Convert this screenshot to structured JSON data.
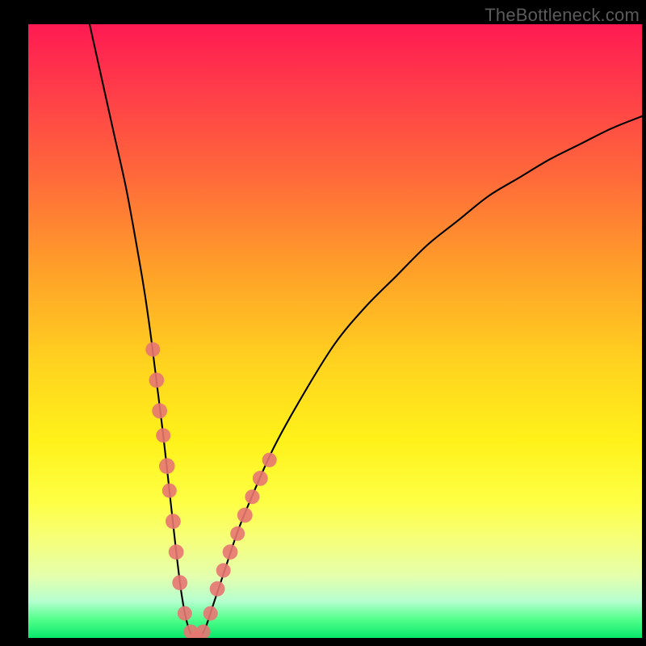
{
  "brand": "TheBottleneck.com",
  "colors": {
    "dot": "#e77572",
    "curve": "#000000",
    "frame": "#000000"
  },
  "chart_data": {
    "type": "line",
    "title": "",
    "xlabel": "",
    "ylabel": "",
    "xlim": [
      0,
      100
    ],
    "ylim": [
      0,
      100
    ],
    "grid": false,
    "legend": false,
    "annotations": [],
    "series": [
      {
        "name": "bottleneck-curve",
        "x": [
          10,
          12,
          14,
          16,
          18,
          19,
          20,
          21,
          22,
          23,
          24,
          25,
          26,
          27,
          28,
          29,
          30,
          32,
          34,
          36,
          40,
          45,
          50,
          55,
          60,
          65,
          70,
          75,
          80,
          85,
          90,
          95,
          100
        ],
        "y": [
          100,
          91,
          82,
          73,
          62,
          56,
          49,
          41,
          33,
          24,
          15,
          7,
          2,
          0,
          0,
          2,
          5,
          11,
          17,
          22,
          31,
          40,
          48,
          54,
          59,
          64,
          68,
          72,
          75,
          78,
          80.5,
          83,
          85
        ]
      }
    ],
    "markers": [
      {
        "x": 20.3,
        "y": 47,
        "r": 1.3
      },
      {
        "x": 20.9,
        "y": 42,
        "r": 1.4
      },
      {
        "x": 21.4,
        "y": 37,
        "r": 1.4
      },
      {
        "x": 22.0,
        "y": 33,
        "r": 1.3
      },
      {
        "x": 22.6,
        "y": 28,
        "r": 1.5
      },
      {
        "x": 23.0,
        "y": 24,
        "r": 1.3
      },
      {
        "x": 23.6,
        "y": 19,
        "r": 1.4
      },
      {
        "x": 24.1,
        "y": 14,
        "r": 1.4
      },
      {
        "x": 24.7,
        "y": 9,
        "r": 1.4
      },
      {
        "x": 25.5,
        "y": 4,
        "r": 1.3
      },
      {
        "x": 26.5,
        "y": 1,
        "r": 1.3
      },
      {
        "x": 27.5,
        "y": 0,
        "r": 1.3
      },
      {
        "x": 28.5,
        "y": 1,
        "r": 1.3
      },
      {
        "x": 29.7,
        "y": 4,
        "r": 1.3
      },
      {
        "x": 30.8,
        "y": 8,
        "r": 1.4
      },
      {
        "x": 31.8,
        "y": 11,
        "r": 1.3
      },
      {
        "x": 32.9,
        "y": 14,
        "r": 1.4
      },
      {
        "x": 34.1,
        "y": 17,
        "r": 1.3
      },
      {
        "x": 35.3,
        "y": 20,
        "r": 1.4
      },
      {
        "x": 36.5,
        "y": 23,
        "r": 1.3
      },
      {
        "x": 37.8,
        "y": 26,
        "r": 1.4
      },
      {
        "x": 39.3,
        "y": 29,
        "r": 1.3
      }
    ]
  }
}
